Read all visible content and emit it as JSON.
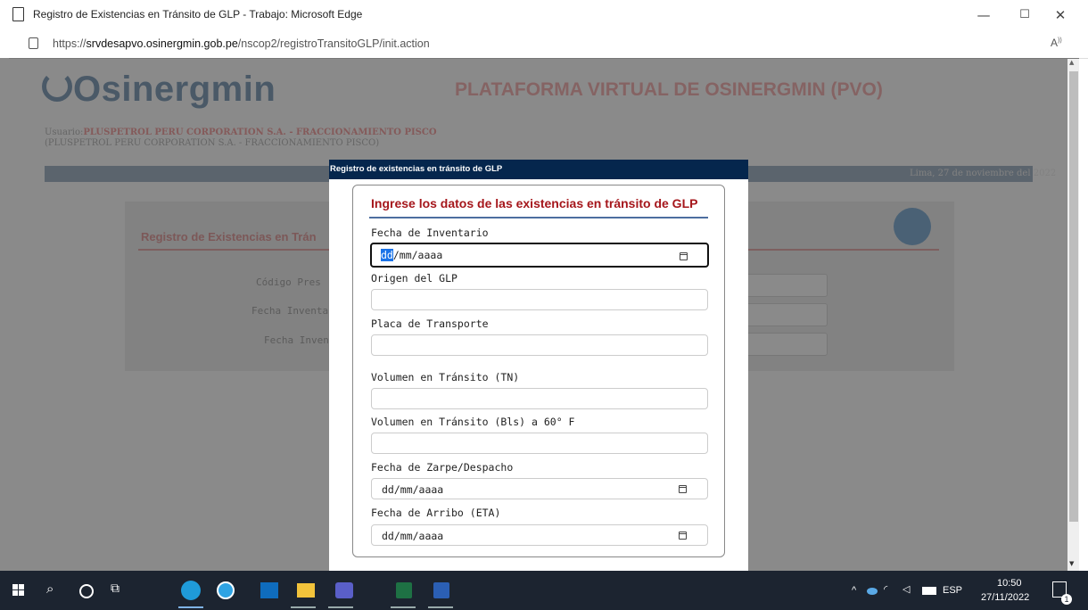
{
  "window": {
    "title": "Registro de Existencias en Tránsito de GLP - Trabajo: Microsoft Edge",
    "minimize": "—",
    "maximize": "☐",
    "close": "✕"
  },
  "address": {
    "url_prefix": "https://",
    "url_host": "srvdesapvo.osinergmin.gob.pe",
    "url_path": "/nscop2/registroTransitoGLP/init.action",
    "read_aloud": "A̅"
  },
  "site": {
    "logo": "Osinergmin",
    "platform_title": "PLATAFORMA VIRTUAL DE OSINERGMIN (PVO)",
    "user_prefix": "Usuario:",
    "user_name": "PLUSPETROL PERU CORPORATION S.A. - FRACCIONAMIENTO PISCO",
    "user_sub": "(PLUSPETROL PERU CORPORATION S.A. - FRACCIONAMIENTO PISCO)",
    "date": "Lima, 27 de noviembre del 2022",
    "panel_title": "Registro de Existencias en Trán",
    "labels": [
      "Código Pres",
      "Fecha Inventari",
      "Fecha Invent"
    ]
  },
  "modal": {
    "header": "Registro de existencias en tránsito de GLP",
    "heading": "Ingrese los datos de las existencias en tránsito de GLP",
    "fields": [
      {
        "label": "Fecha de Inventario",
        "type": "date",
        "value": "dd/mm/aaaa",
        "selected": "dd"
      },
      {
        "label": "Origen del GLP",
        "type": "text",
        "value": ""
      },
      {
        "label": "Placa de Transporte",
        "type": "text",
        "value": ""
      },
      {
        "label": "Volumen en Tránsito (TN)",
        "type": "text",
        "value": ""
      },
      {
        "label": "Volumen en Tránsito (Bls) a 60° F",
        "type": "text",
        "value": ""
      },
      {
        "label": "Fecha de Zarpe/Despacho",
        "type": "date",
        "value": "dd/mm/aaaa"
      },
      {
        "label": "Fecha de Arribo (ETA)",
        "type": "date",
        "value": "dd/mm/aaaa"
      }
    ],
    "date_rest": "/mm/aaaa"
  },
  "taskbar": {
    "lang": "ESP",
    "time": "10:50",
    "date": "27/11/2022",
    "notif_count": "1"
  },
  "colors": {
    "modal_header": "#05264d",
    "heading_red": "#a5161b",
    "taskbar": "#1c2430"
  }
}
